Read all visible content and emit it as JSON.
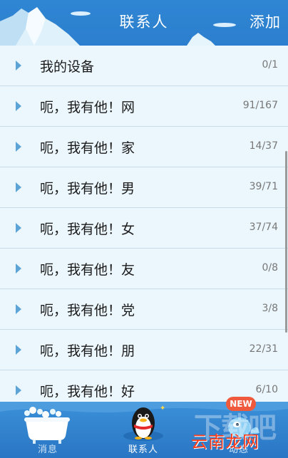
{
  "header": {
    "title": "联系人",
    "add_label": "添加"
  },
  "groups": [
    {
      "name": "我的设备",
      "count": "0/1"
    },
    {
      "name": "呃，我有他！网",
      "count": "91/167"
    },
    {
      "name": "呃，我有他！家",
      "count": "14/37"
    },
    {
      "name": "呃，我有他！男",
      "count": "39/71"
    },
    {
      "name": "呃，我有他！女",
      "count": "37/74"
    },
    {
      "name": "呃，我有他！友",
      "count": "0/8"
    },
    {
      "name": "呃，我有他！党",
      "count": "3/8"
    },
    {
      "name": "呃，我有他！朋",
      "count": "22/31"
    },
    {
      "name": "呃，我有他！好",
      "count": "6/10"
    }
  ],
  "tabs": {
    "messages": "消息",
    "contacts": "联系人",
    "dynamics": "动态"
  },
  "badge": {
    "new": "NEW"
  },
  "watermark": {
    "faint": "下载吧",
    "brand": "云南龙网"
  },
  "colors": {
    "header_blue": "#2f86d3",
    "list_bg": "#eaf6fc",
    "arrow": "#5da4d6",
    "badge": "#ef5a3c"
  }
}
